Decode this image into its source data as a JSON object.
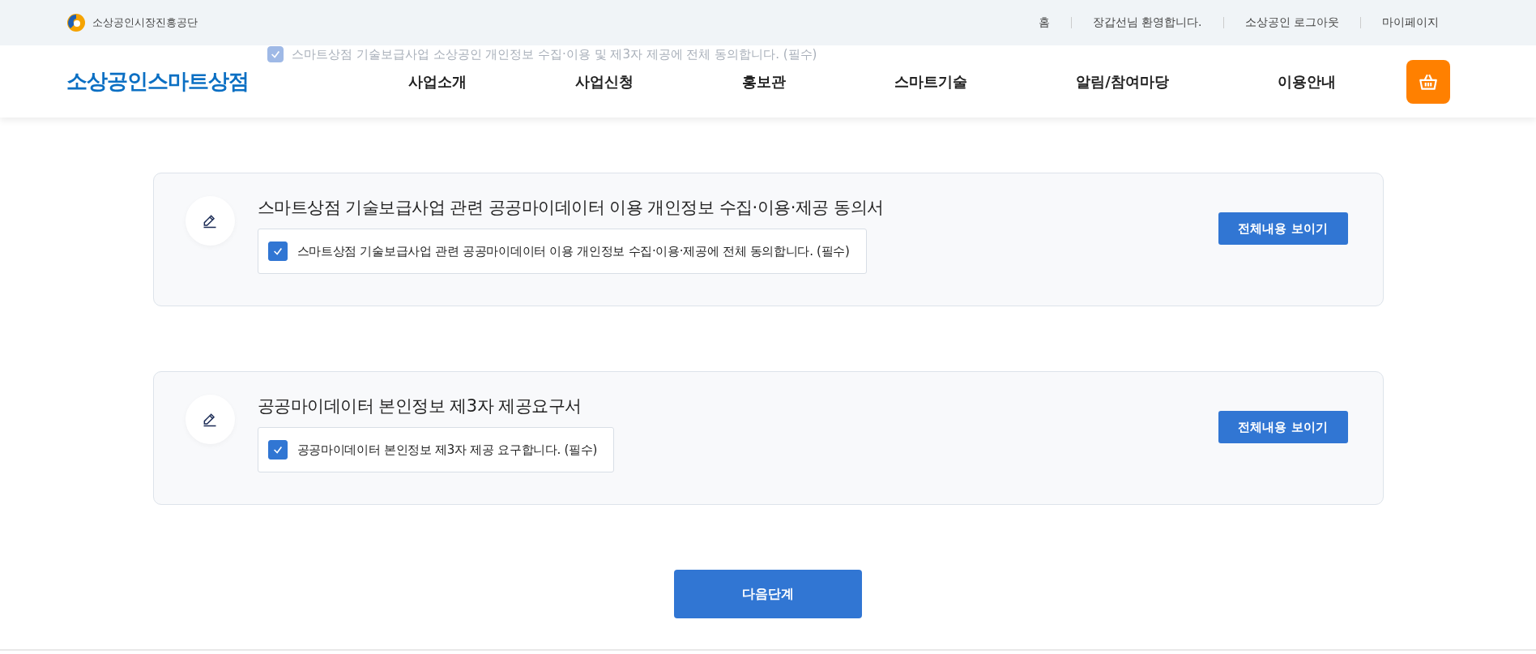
{
  "top_bar": {
    "org_name": "소상공인시장진흥공단",
    "links": [
      "홈",
      "장갑선님 환영합니다.",
      "소상공인 로그아웃",
      "마이페이지"
    ]
  },
  "background_agreement": {
    "label": "스마트상점 기술보급사업 소상공인 개인정보 수집·이용 및 제3자 제공에 전체 동의합니다. (필수)",
    "checked": true
  },
  "nav": {
    "brand": "소상공인스마트상점",
    "items": [
      "사업소개",
      "사업신청",
      "홍보관",
      "스마트기술",
      "알림/참여마당",
      "이용안내"
    ]
  },
  "agreements": [
    {
      "title": "스마트상점 기술보급사업 관련 공공마이데이터 이용 개인정보 수집·이용·제공 동의서",
      "checkbox_label": "스마트상점 기술보급사업 관련 공공마이데이터 이용 개인정보 수집·이용·제공에 전체 동의합니다. (필수)",
      "checked": true,
      "button": "전체내용 보이기"
    },
    {
      "title": "공공마이데이터 본인정보 제3자 제공요구서",
      "checkbox_label": "공공마이데이터 본인정보 제3자 제공 요구합니다. (필수)",
      "checked": true,
      "button": "전체내용 보이기"
    }
  ],
  "next_button": "다음단계"
}
